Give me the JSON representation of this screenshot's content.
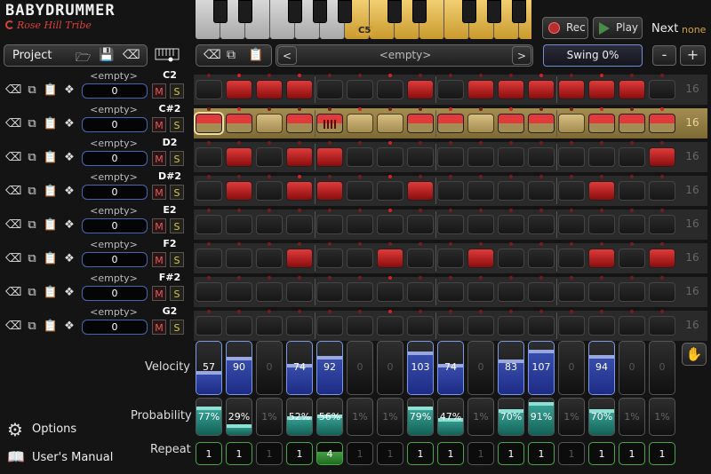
{
  "app": {
    "title": "BABYDRUMMER",
    "company": "Rose Hill Tribe"
  },
  "keyboard": {
    "current_key_label": "C5"
  },
  "transport": {
    "rec_label": "Rec",
    "play_label": "Play",
    "next_label": "Next",
    "next_value": "none"
  },
  "project": {
    "label": "Project"
  },
  "pattern": {
    "name": "<empty>",
    "prev_symbol": "<",
    "next_symbol": ">"
  },
  "swing": {
    "label": "Swing 0%"
  },
  "length_controls": {
    "minus": "-",
    "plus": "+"
  },
  "tracks": [
    {
      "sample": "<empty>",
      "value": "0",
      "note": "C2",
      "mute": "M",
      "solo": "S",
      "length": "16",
      "selected": false,
      "steps": [
        0,
        1,
        1,
        1,
        0,
        0,
        0,
        1,
        0,
        1,
        1,
        1,
        1,
        1,
        1,
        0
      ],
      "dots": [
        0,
        1,
        0,
        1,
        0,
        0,
        1,
        0,
        0,
        0,
        0,
        1,
        0,
        1,
        0,
        0
      ]
    },
    {
      "sample": "<empty>",
      "value": "0",
      "note": "C#2",
      "mute": "M",
      "solo": "S",
      "length": "16",
      "selected": true,
      "steps": [
        1,
        1,
        0,
        1,
        1,
        0,
        0,
        1,
        1,
        0,
        1,
        1,
        0,
        1,
        1,
        1
      ],
      "dots": [
        0,
        1,
        0,
        0,
        0,
        1,
        0,
        0,
        1,
        0,
        1,
        0,
        0,
        1,
        0,
        1
      ]
    },
    {
      "sample": "<empty>",
      "value": "0",
      "note": "D2",
      "mute": "M",
      "solo": "S",
      "length": "16",
      "selected": false,
      "steps": [
        0,
        1,
        0,
        1,
        1,
        0,
        0,
        0,
        0,
        0,
        0,
        0,
        0,
        0,
        0,
        1
      ],
      "dots": [
        0,
        0,
        0,
        0,
        0,
        0,
        1,
        0,
        0,
        0,
        0,
        0,
        0,
        0,
        0,
        0
      ]
    },
    {
      "sample": "<empty>",
      "value": "0",
      "note": "D#2",
      "mute": "M",
      "solo": "S",
      "length": "16",
      "selected": false,
      "steps": [
        0,
        1,
        0,
        1,
        1,
        0,
        0,
        1,
        0,
        0,
        0,
        0,
        0,
        1,
        0,
        0
      ],
      "dots": [
        0,
        0,
        0,
        1,
        0,
        0,
        1,
        0,
        0,
        0,
        0,
        0,
        0,
        0,
        0,
        0
      ]
    },
    {
      "sample": "<empty>",
      "value": "0",
      "note": "E2",
      "mute": "M",
      "solo": "S",
      "length": "16",
      "selected": false,
      "steps": [
        0,
        0,
        0,
        0,
        0,
        0,
        0,
        0,
        0,
        0,
        0,
        0,
        0,
        0,
        0,
        0
      ],
      "dots": [
        0,
        0,
        0,
        0,
        0,
        0,
        1,
        0,
        0,
        0,
        0,
        0,
        0,
        0,
        0,
        0
      ]
    },
    {
      "sample": "<empty>",
      "value": "0",
      "note": "F2",
      "mute": "M",
      "solo": "S",
      "length": "16",
      "selected": false,
      "steps": [
        0,
        0,
        0,
        1,
        0,
        0,
        1,
        0,
        0,
        1,
        0,
        0,
        0,
        1,
        0,
        1
      ],
      "dots": [
        0,
        0,
        0,
        0,
        0,
        0,
        0,
        0,
        0,
        0,
        0,
        0,
        0,
        0,
        0,
        0
      ]
    },
    {
      "sample": "<empty>",
      "value": "0",
      "note": "F#2",
      "mute": "M",
      "solo": "S",
      "length": "16",
      "selected": false,
      "steps": [
        0,
        0,
        0,
        0,
        0,
        0,
        0,
        0,
        0,
        0,
        0,
        0,
        0,
        0,
        0,
        0
      ],
      "dots": [
        0,
        0,
        0,
        0,
        0,
        0,
        1,
        0,
        0,
        0,
        0,
        0,
        0,
        0,
        0,
        0
      ]
    },
    {
      "sample": "<empty>",
      "value": "0",
      "note": "G2",
      "mute": "M",
      "solo": "S",
      "length": "16",
      "selected": false,
      "steps": [
        0,
        0,
        0,
        0,
        0,
        0,
        0,
        0,
        0,
        0,
        0,
        0,
        0,
        0,
        0,
        0
      ],
      "dots": [
        0,
        0,
        0,
        0,
        0,
        0,
        1,
        0,
        0,
        0,
        0,
        0,
        0,
        0,
        0,
        0
      ]
    }
  ],
  "velocity": {
    "label": "Velocity",
    "values": [
      57,
      90,
      0,
      74,
      92,
      0,
      0,
      103,
      74,
      0,
      83,
      107,
      0,
      94,
      0,
      0
    ]
  },
  "probability": {
    "label": "Probability",
    "values": [
      "77%",
      "29%",
      "1%",
      "52%",
      "56%",
      "1%",
      "1%",
      "79%",
      "47%",
      "1%",
      "70%",
      "91%",
      "1%",
      "70%",
      "1%",
      "1%"
    ]
  },
  "repeat": {
    "label": "Repeat",
    "values": [
      1,
      1,
      1,
      1,
      4,
      1,
      1,
      1,
      1,
      1,
      1,
      1,
      1,
      1,
      1,
      1
    ]
  },
  "footer": {
    "options_label": "Options",
    "manual_label": "User's Manual"
  },
  "colors": {
    "accent_red": "#e03a3a",
    "accent_gold": "#d6a535",
    "velocity_blue": "#2c3fa0",
    "probability_teal": "#2a8a7c",
    "repeat_green": "#3a8f3a"
  }
}
